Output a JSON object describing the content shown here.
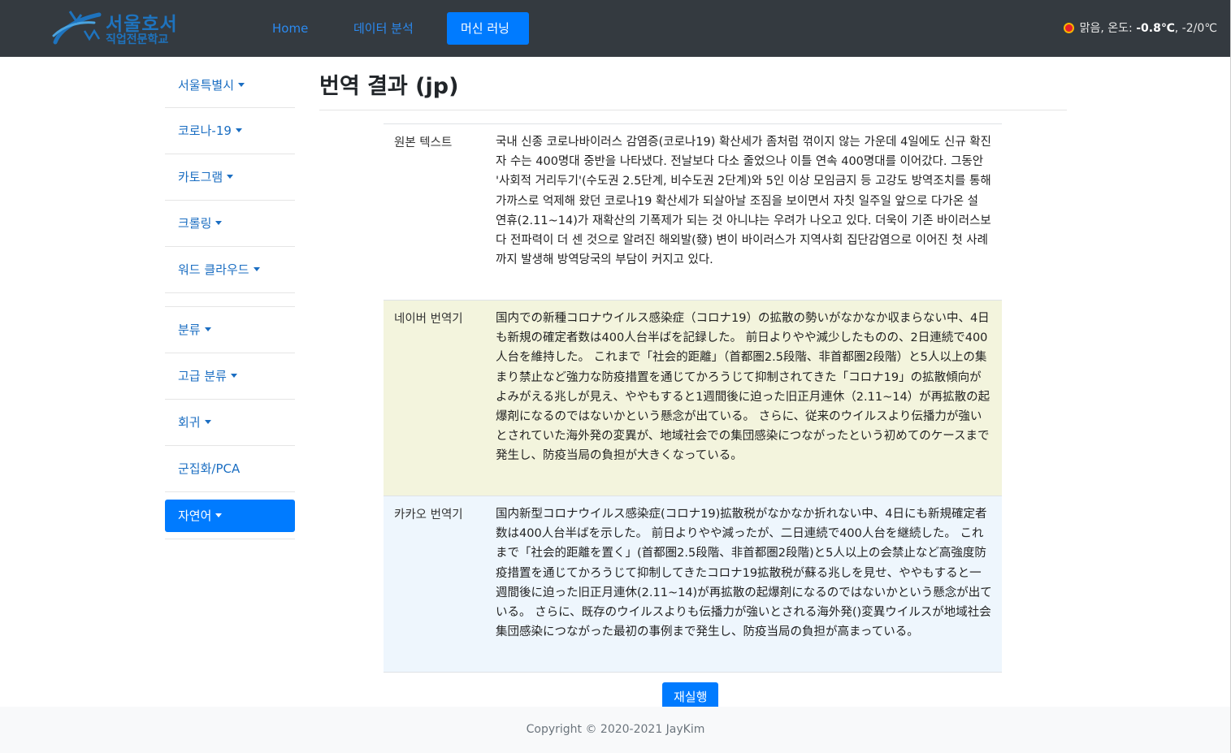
{
  "brand": {
    "line1": "서울호서",
    "line2": "직업전문학교"
  },
  "nav": {
    "items": [
      {
        "label": "Home"
      },
      {
        "label": "데이터 분석"
      },
      {
        "label": "머신 러닝",
        "active": true
      }
    ]
  },
  "weather": {
    "icon": "sun-icon",
    "prefix": "맑음, 온도: ",
    "temp": "-0.8℃",
    "range": ", -2/0℃"
  },
  "sidebar": {
    "items": [
      {
        "label": "서울특별시",
        "dropdown": true
      },
      {
        "label": "코로나-19",
        "dropdown": true
      },
      {
        "label": "카토그램",
        "dropdown": true
      },
      {
        "label": "크롤링",
        "dropdown": true
      },
      {
        "label": "워드 클라우드",
        "dropdown": true
      },
      {
        "label": "분류",
        "dropdown": true
      },
      {
        "label": "고급 분류",
        "dropdown": true
      },
      {
        "label": "회귀",
        "dropdown": true
      },
      {
        "label": "군집화/PCA",
        "dropdown": false
      },
      {
        "label": "자연어",
        "dropdown": true,
        "active": true
      }
    ]
  },
  "main": {
    "title": "번역 결과 (jp)",
    "rows": [
      {
        "label": "원본 텍스트",
        "text": "국내 신종 코로나바이러스 감염증(코로나19) 확산세가 좀처럼 꺾이지 않는 가운데 4일에도 신규 확진자 수는 400명대 중반을 나타냈다. 전날보다 다소 줄었으나 이틀 연속 400명대를 이어갔다. 그동안 '사회적 거리두기'(수도권 2.5단계, 비수도권 2단계)와 5인 이상 모임금지 등 고강도 방역조치를 통해 가까스로 억제해 왔던 코로나19 확산세가 되살아날 조짐을 보이면서 자칫 일주일 앞으로 다가온 설 연휴(2.11~14)가 재확산의 기폭제가 되는 것 아니냐는 우려가 나오고 있다. 더욱이 기존 바이러스보다 전파력이 더 센 것으로 알려진 해외발(發) 변이 바이러스가 지역사회 집단감염으로 이어진 첫 사례까지 발생해 방역당국의 부담이 커지고 있다."
      },
      {
        "label": "네이버 번역기",
        "text": "国内での新種コロナウイルス感染症（コロナ19）の拡散の勢いがなかなか収まらない中、4日も新規の確定者数は400人台半ばを記録した。 前日よりやや減少したものの、2日連続で400人台を維持した。 これまで「社会的距離」（首都圏2.5段階、非首都圏2段階）と5人以上の集まり禁止など強力な防疫措置を通じてかろうじて抑制されてきた「コロナ19」の拡散傾向がよみがえる兆しが見え、ややもすると1週間後に迫った旧正月連休（2.11~14）が再拡散の起爆剤になるのではないかという懸念が出ている。 さらに、従来のウイルスより伝播力が強いとされていた海外発の変異が、地域社会での集団感染につながったという初めてのケースまで発生し、防疫当局の負担が大きくなっている。"
      },
      {
        "label": "카카오 번역기",
        "text": "国内新型コロナウイルス感染症(コロナ19)拡散税がなかなか折れない中、4日にも新規確定者数は400人台半ばを示した。 前日よりやや減ったが、二日連続で400人台を継続した。 これまで「社会的距離を置く」(首都圏2.5段階、非首都圏2段階)と5人以上の会禁止など高強度防疫措置を通じてかろうじて抑制してきたコロナ19拡散税が蘇る兆しを見せ、ややもすると一週間後に迫った旧正月連休(2.11~14)が再拡散の起爆剤になるのではないかという懸念が出ている。 さらに、既存のウイルスよりも伝播力が強いとされる海外発()変異ウイルスが地域社会集団感染につながった最初の事例まで発生し、防疫当局の負担が高まっている。"
      }
    ],
    "rerun_label": "재실행"
  },
  "footer": {
    "copyright": "Copyright © 2020-2021 JayKim"
  },
  "colors": {
    "navbar": "#343a40",
    "accent": "#007bff",
    "naver_row": "#f3f4dd",
    "kakao_row": "#eef6fd"
  }
}
